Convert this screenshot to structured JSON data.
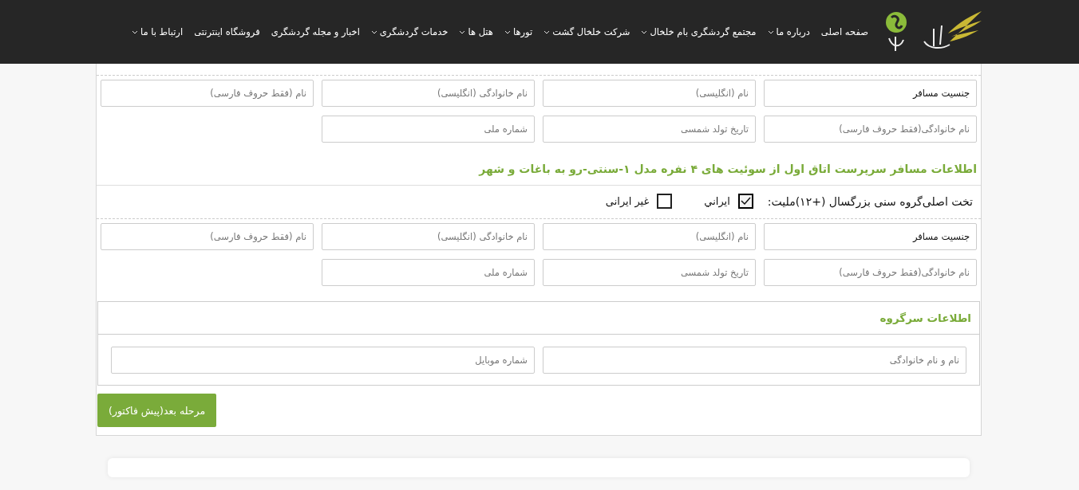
{
  "nav": [
    {
      "label": "صفحه اصلی",
      "dropdown": false
    },
    {
      "label": "درباره ما",
      "dropdown": true
    },
    {
      "label": "مجتمع گردشگری بام خلخال",
      "dropdown": true
    },
    {
      "label": "شرکت خلخال گشت",
      "dropdown": true
    },
    {
      "label": "تورها",
      "dropdown": true
    },
    {
      "label": "هتل ها",
      "dropdown": true
    },
    {
      "label": "خدمات گردشگری",
      "dropdown": true
    },
    {
      "label": "اخبار و مجله گردشگری",
      "dropdown": false
    },
    {
      "label": "فروشگاه اینترنتی",
      "dropdown": false
    },
    {
      "label": "ارتباط با ما",
      "dropdown": true
    }
  ],
  "passengers": [
    {
      "fields": [
        {
          "kind": "select",
          "value": "جنسیت مسافر"
        },
        {
          "kind": "text",
          "placeholder": "نام (انگلیسی)"
        },
        {
          "kind": "text",
          "placeholder": "نام خانوادگی (انگلیسی)"
        },
        {
          "kind": "text",
          "placeholder": "نام (فقط حروف فارسی)"
        },
        {
          "kind": "text",
          "placeholder": "نام خانوادگی(فقط حروف فارسی)"
        },
        {
          "kind": "text",
          "placeholder": "تاریخ تولد شمسی"
        },
        {
          "kind": "text",
          "placeholder": "شماره ملی"
        }
      ]
    },
    {
      "title": "اطلاعات مسافر سرپرست اتاق اول از سوئیت های ۴ نفره مدل ۱-سنتی-رو به باغات و شهر",
      "nationality": {
        "label": "تخت اصلی‌گروه سنی بزرگسال (+۱۲)ملیت:",
        "options": [
          {
            "label": "ايراني",
            "selected": true
          },
          {
            "label": "غیر ایرانی",
            "selected": false
          }
        ]
      },
      "fields": [
        {
          "kind": "select",
          "value": "جنسیت مسافر"
        },
        {
          "kind": "text",
          "placeholder": "نام (انگلیسی)"
        },
        {
          "kind": "text",
          "placeholder": "نام خانوادگی (انگلیسی)"
        },
        {
          "kind": "text",
          "placeholder": "نام (فقط حروف فارسی)"
        },
        {
          "kind": "text",
          "placeholder": "نام خانوادگی(فقط حروف فارسی)"
        },
        {
          "kind": "text",
          "placeholder": "تاریخ تولد شمسی"
        },
        {
          "kind": "text",
          "placeholder": "شماره ملی"
        }
      ]
    }
  ],
  "leader": {
    "title": "اطلاعات سرگروه",
    "fields": [
      {
        "placeholder": "نام و نام خانوادگی"
      },
      {
        "placeholder": "شماره موبایل"
      }
    ]
  },
  "next_button": "مرحله بعد(پیش فاکتور)"
}
